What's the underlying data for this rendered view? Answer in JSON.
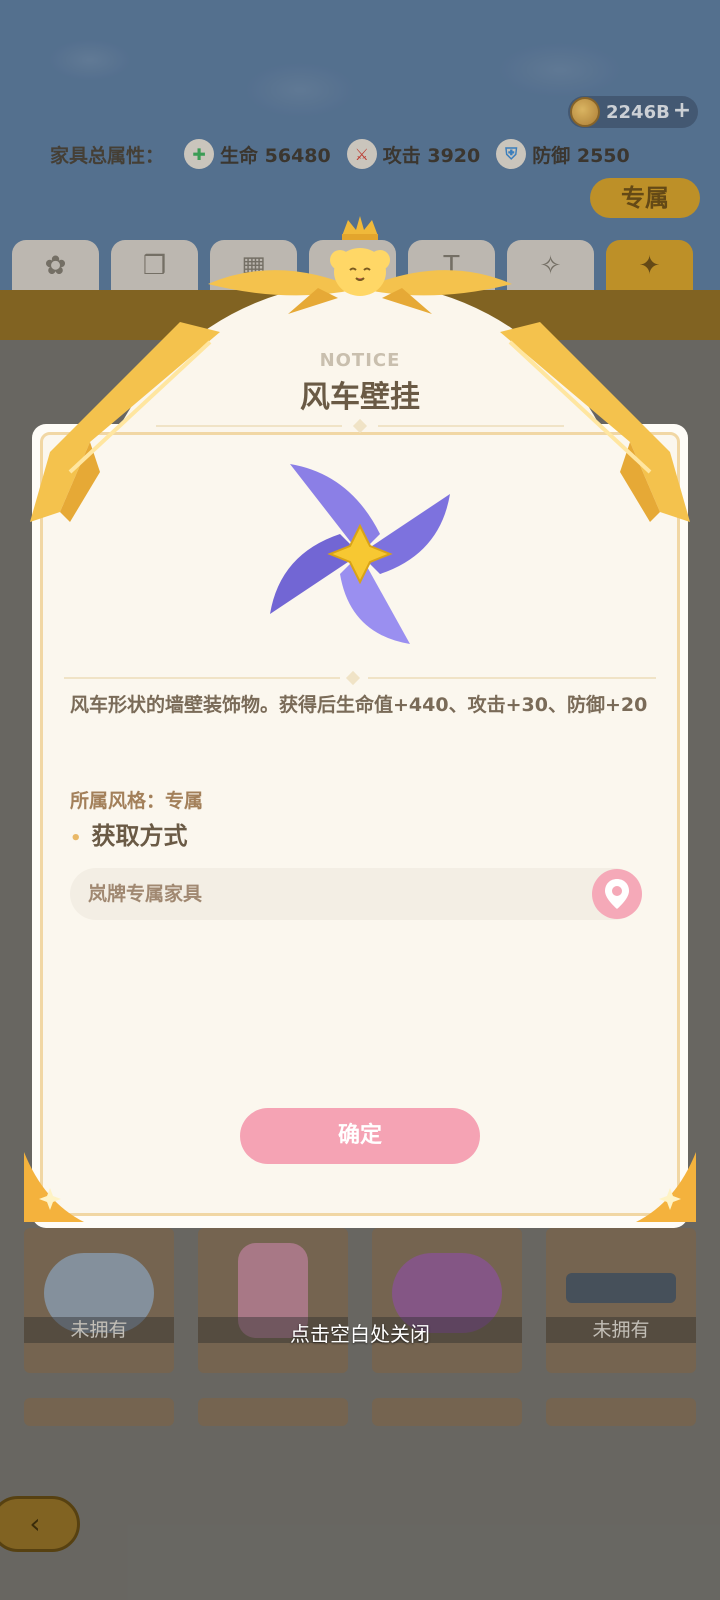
{
  "header": {
    "currency_amount": "2246B",
    "stats_label": "家具总属性：",
    "stats": [
      {
        "icon": "heart-plus-icon",
        "text": "生命 56480",
        "color": "#3fa65b"
      },
      {
        "icon": "sword-icon",
        "text": "攻击 3920",
        "color": "#c8453a"
      },
      {
        "icon": "shield-icon",
        "text": "防御 2550",
        "color": "#3f86c8"
      }
    ],
    "exclusive_tag": "专属"
  },
  "tabs": [
    {
      "icon": "clover-icon",
      "glyph": "✿"
    },
    {
      "icon": "book-icon",
      "glyph": "❒"
    },
    {
      "icon": "bricks-icon",
      "glyph": "▦"
    },
    {
      "icon": "table-icon",
      "glyph": "☖"
    },
    {
      "icon": "lamp-icon",
      "glyph": "T"
    },
    {
      "icon": "wand-icon",
      "glyph": "✧"
    },
    {
      "icon": "star-icon",
      "glyph": "✦",
      "active": true
    }
  ],
  "grid": {
    "not_owned_label": "未拥有"
  },
  "dialog": {
    "notice_label": "NOTICE",
    "title": "风车壁挂",
    "description": "风车形状的墙壁装饰物。获得后生命值+440、攻击+30、防御+20",
    "style_line": "所属风格：专属",
    "acquire_heading": "获取方式",
    "source_text": "岚牌专属家具",
    "confirm_label": "确定"
  },
  "close_hint": "点击空白处关闭",
  "colors": {
    "accent_pink": "#f5a3b4",
    "ribbon_gold": "#f4c24d",
    "tab_active": "#c99a2b",
    "pinwheel_purple": "#8b7fe6"
  }
}
